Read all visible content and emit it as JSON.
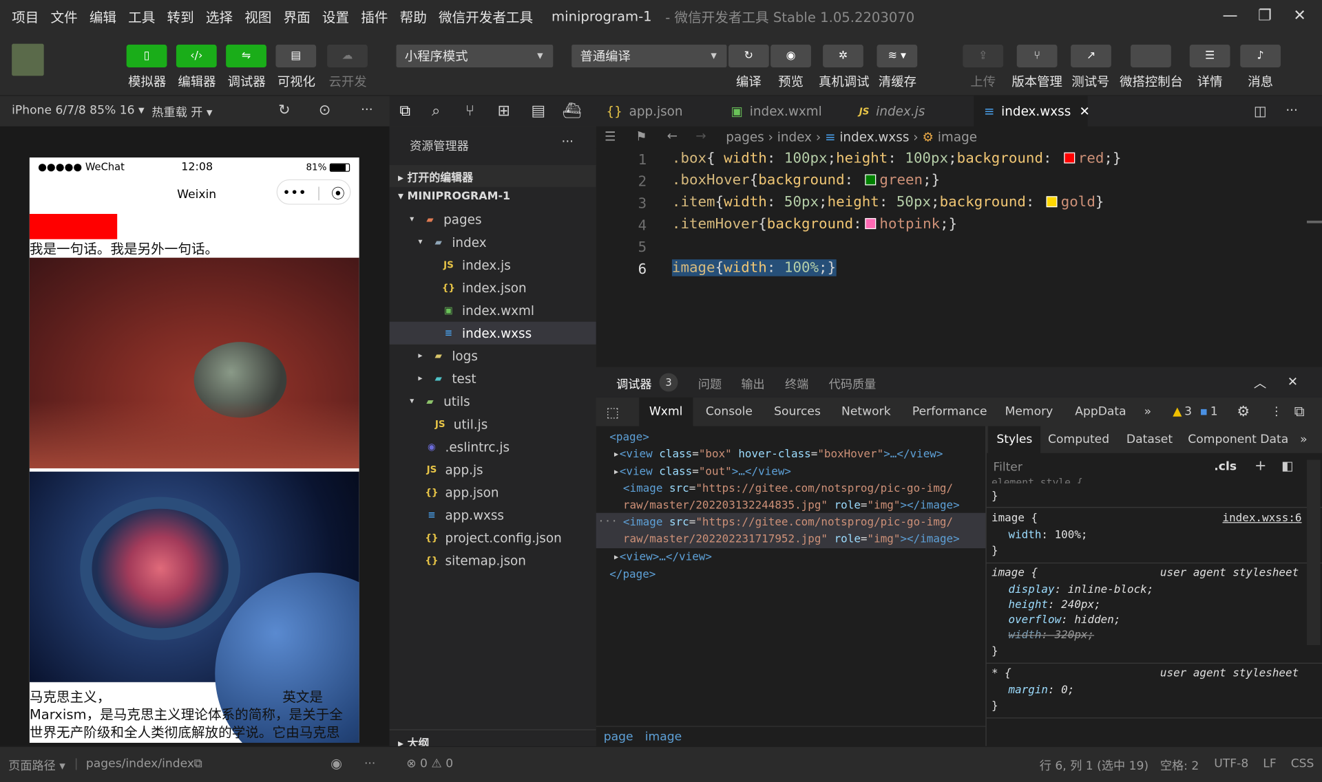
{
  "menubar": {
    "items": [
      "项目",
      "文件",
      "编辑",
      "工具",
      "转到",
      "选择",
      "视图",
      "界面",
      "设置",
      "插件",
      "帮助",
      "微信开发者工具"
    ],
    "title": "miniprogram-1",
    "version": "- 微信开发者工具 Stable 1.05.2203070"
  },
  "toolbar": {
    "simulator": "模拟器",
    "editor": "编辑器",
    "debugger": "调试器",
    "visual": "可视化",
    "cloud": "云开发",
    "mode_select": "小程序模式",
    "compile_select": "普通编译",
    "compile": "编译",
    "preview": "预览",
    "real_debug": "真机调试",
    "clear_cache": "清缓存",
    "upload": "上传",
    "version_mgmt": "版本管理",
    "test_account": "测试号",
    "console_panel": "微搭控制台",
    "details": "详情",
    "messages": "消息"
  },
  "simbar": {
    "device": "iPhone 6/7/8 85% 16",
    "hot_reload": "热重载 开"
  },
  "phone": {
    "carrier": "●●●●● WeChat",
    "time": "12:08",
    "battery": "81%",
    "nav_title": "Weixin",
    "line1": "我是一句话。我是另外一句话。",
    "para_line1a": "马克思主义，",
    "para_line1b": "英文是",
    "para_line2": "Marxism，是马克思主义理论体系的简称，是关于全",
    "para_line3": "世界无产阶级和全人类彻底解放的学说。它由马克思"
  },
  "explorer": {
    "title": "资源管理器",
    "open_editors": "打开的编辑器",
    "project": "MINIPROGRAM-1",
    "outline": "大纲",
    "files": [
      {
        "name": "pages",
        "icon": "folder-icon"
      },
      {
        "name": "index",
        "icon": "folder-open-icon"
      },
      {
        "name": "index.js",
        "icon": "js-file-icon"
      },
      {
        "name": "index.json",
        "icon": "json-file-icon"
      },
      {
        "name": "index.wxml",
        "icon": "wxml-file-icon"
      },
      {
        "name": "index.wxss",
        "icon": "wxss-file-icon"
      },
      {
        "name": "logs",
        "icon": "folder-icon"
      },
      {
        "name": "test",
        "icon": "folder-icon"
      },
      {
        "name": "utils",
        "icon": "folder-open-icon"
      },
      {
        "name": "util.js",
        "icon": "js-file-icon"
      },
      {
        "name": ".eslintrc.js",
        "icon": "eslint-file-icon"
      },
      {
        "name": "app.js",
        "icon": "js-file-icon"
      },
      {
        "name": "app.json",
        "icon": "json-file-icon"
      },
      {
        "name": "app.wxss",
        "icon": "wxss-file-icon"
      },
      {
        "name": "project.config.json",
        "icon": "json-file-icon"
      },
      {
        "name": "sitemap.json",
        "icon": "json-file-icon"
      }
    ]
  },
  "tabs": [
    "app.json",
    "index.wxml",
    "index.js",
    "index.wxss"
  ],
  "breadcrumb": {
    "p1": "pages",
    "p2": "index",
    "p3": "index.wxss",
    "p4": "image"
  },
  "code": {
    "l1": {
      "sel": ".box",
      "a": "width",
      "av": "100px",
      "b": "height",
      "bv": "100px",
      "c": "background",
      "cv": "red"
    },
    "l2": {
      "sel": ".boxHover",
      "a": "background",
      "av": "green"
    },
    "l3": {
      "sel": ".item",
      "a": "width",
      "av": "50px",
      "b": "height",
      "bv": "50px",
      "c": "background",
      "cv": "gold"
    },
    "l4": {
      "sel": ".itemHover",
      "a": "background",
      "av": "hotpink"
    },
    "l6": {
      "sel": "image",
      "a": "width",
      "av": "100%"
    },
    "swatches": {
      "red": "#ff0000",
      "green": "#008000",
      "gold": "#ffd700",
      "hotpink": "#ff69b4"
    }
  },
  "devtools": {
    "tab_debugger": "调试器",
    "badge": "3",
    "tab_problems": "问题",
    "tab_output": "输出",
    "tab_terminal": "终端",
    "tab_quality": "代码质量",
    "panels": {
      "wxml": "Wxml",
      "console": "Console",
      "sources": "Sources",
      "network": "Network",
      "performance": "Performance",
      "memory": "Memory",
      "appdata": "AppData"
    },
    "warn_count": "3",
    "info_count": "1"
  },
  "wxml_tree": {
    "page_open": "<page>",
    "page_close": "</page>",
    "view_box_cls": "box",
    "view_box_hover": "boxHover",
    "view_out_cls": "out",
    "img1_src": "https://gitee.com/notsprog/pic-go-img/",
    "img1_src2": "raw/master/202203132244835.jpg",
    "img2_src": "https://gitee.com/notsprog/pic-go-img/",
    "img2_src2": "raw/master/202202231717952.jpg",
    "role": "img",
    "crumb_page": "page",
    "crumb_image": "image"
  },
  "styles": {
    "tabs": [
      "Styles",
      "Computed",
      "Dataset",
      "Component Data"
    ],
    "filter": "Filter",
    "cls": ".cls",
    "cut_text": "element.style {",
    "r1_sel": "image {",
    "r1_src": "index.wxss:6",
    "r1_p": "width",
    "r1_v": "100%;",
    "r2_sel": "image {",
    "ua": "user agent stylesheet",
    "r2_p1": "display",
    "r2_v1": "inline-block;",
    "r2_p2": "height",
    "r2_v2": "240px;",
    "r2_p3": "overflow",
    "r2_v3": "hidden;",
    "r2_p4": "width",
    "r2_v4": "320px;",
    "r3_sel": "* {",
    "r3_p": "margin",
    "r3_v": "0;"
  },
  "statusbar": {
    "page_path": "页面路径",
    "path": "pages/index/index",
    "errors": "0",
    "warnings": "0",
    "pos": "行 6, 列 1 (选中 19)",
    "spaces": "空格: 2",
    "encoding": "UTF-8",
    "eol": "LF",
    "lang": "CSS"
  }
}
